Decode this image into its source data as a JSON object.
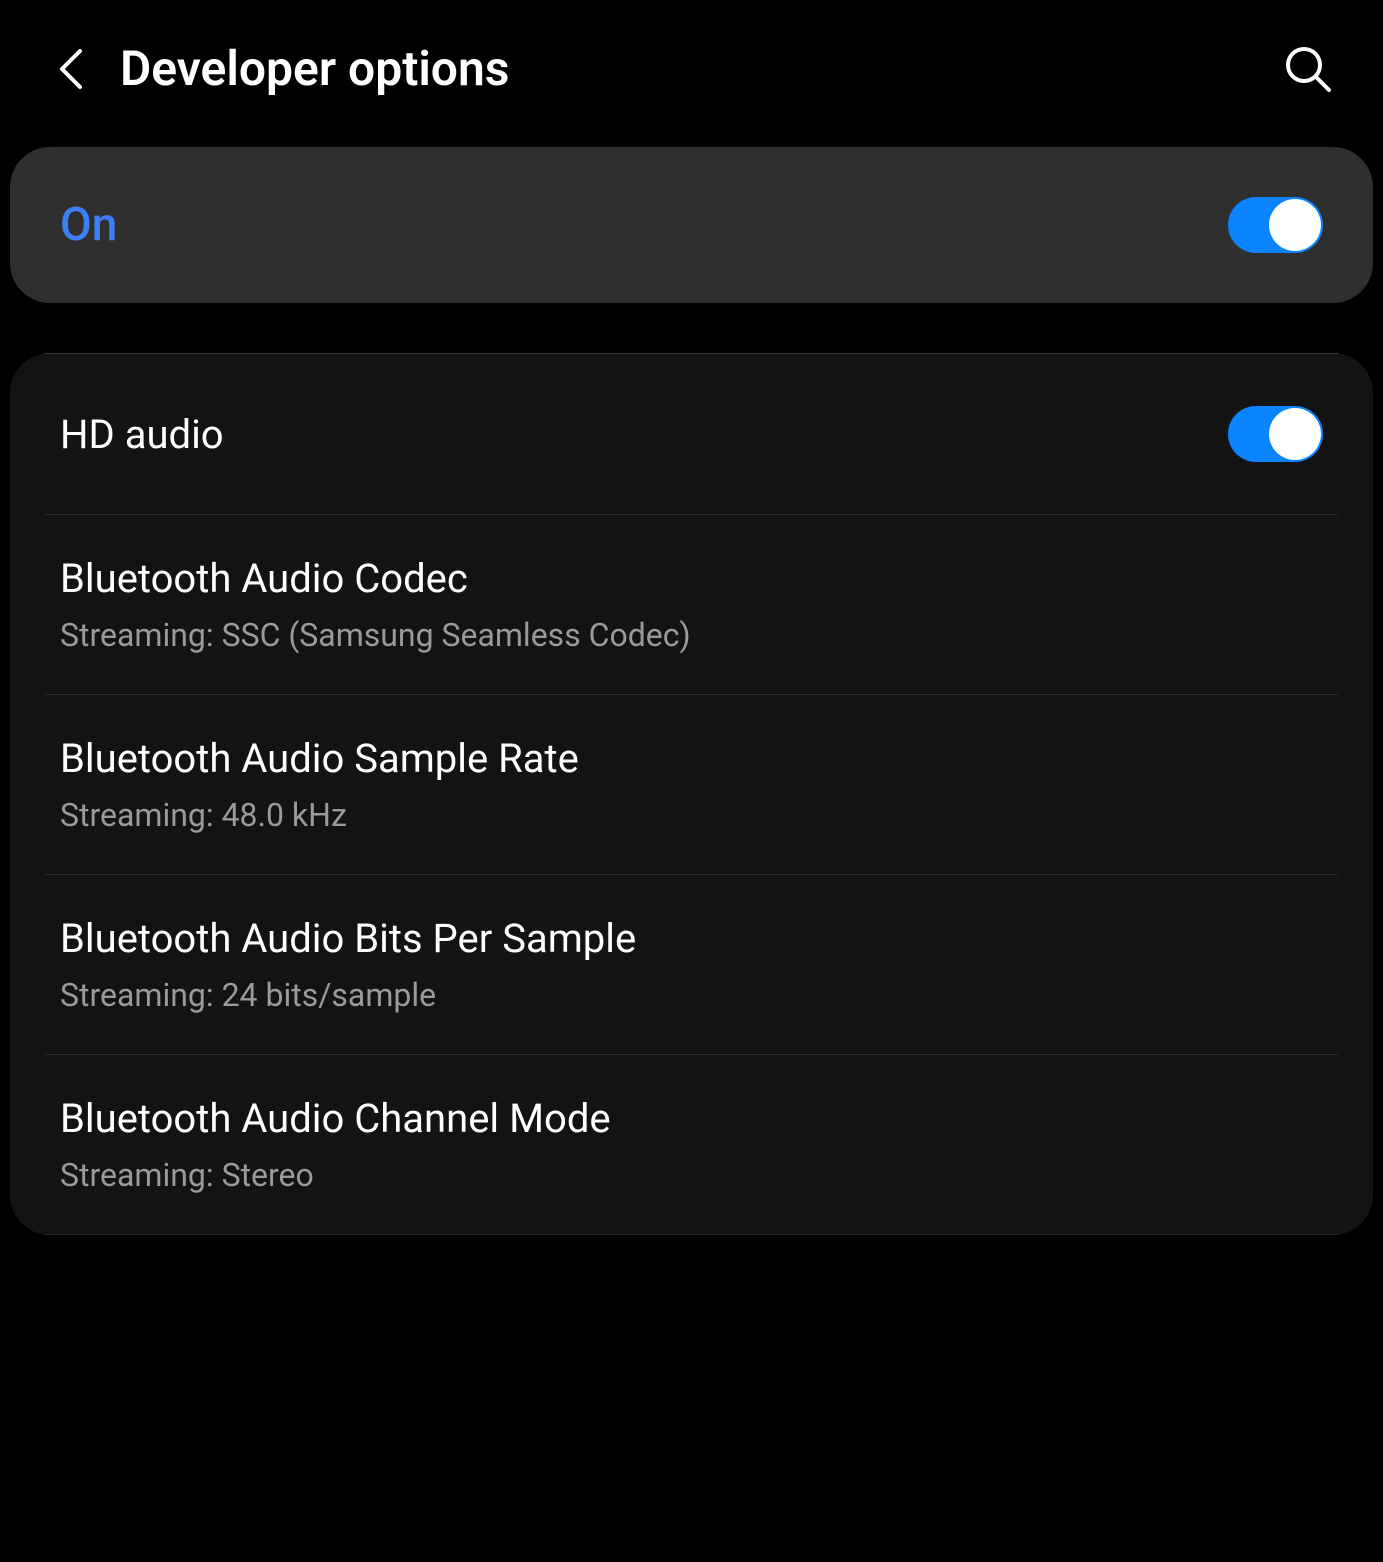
{
  "header": {
    "title": "Developer options"
  },
  "master": {
    "label": "On",
    "enabled": true
  },
  "settings": [
    {
      "title": "HD audio",
      "toggle": true,
      "enabled": true
    },
    {
      "title": "Bluetooth Audio Codec",
      "subtitle": "Streaming: SSC (Samsung Seamless Codec)"
    },
    {
      "title": "Bluetooth Audio Sample Rate",
      "subtitle": "Streaming: 48.0 kHz"
    },
    {
      "title": "Bluetooth Audio Bits Per Sample",
      "subtitle": "Streaming: 24 bits/sample"
    },
    {
      "title": "Bluetooth Audio Channel Mode",
      "subtitle": "Streaming: Stereo"
    }
  ]
}
